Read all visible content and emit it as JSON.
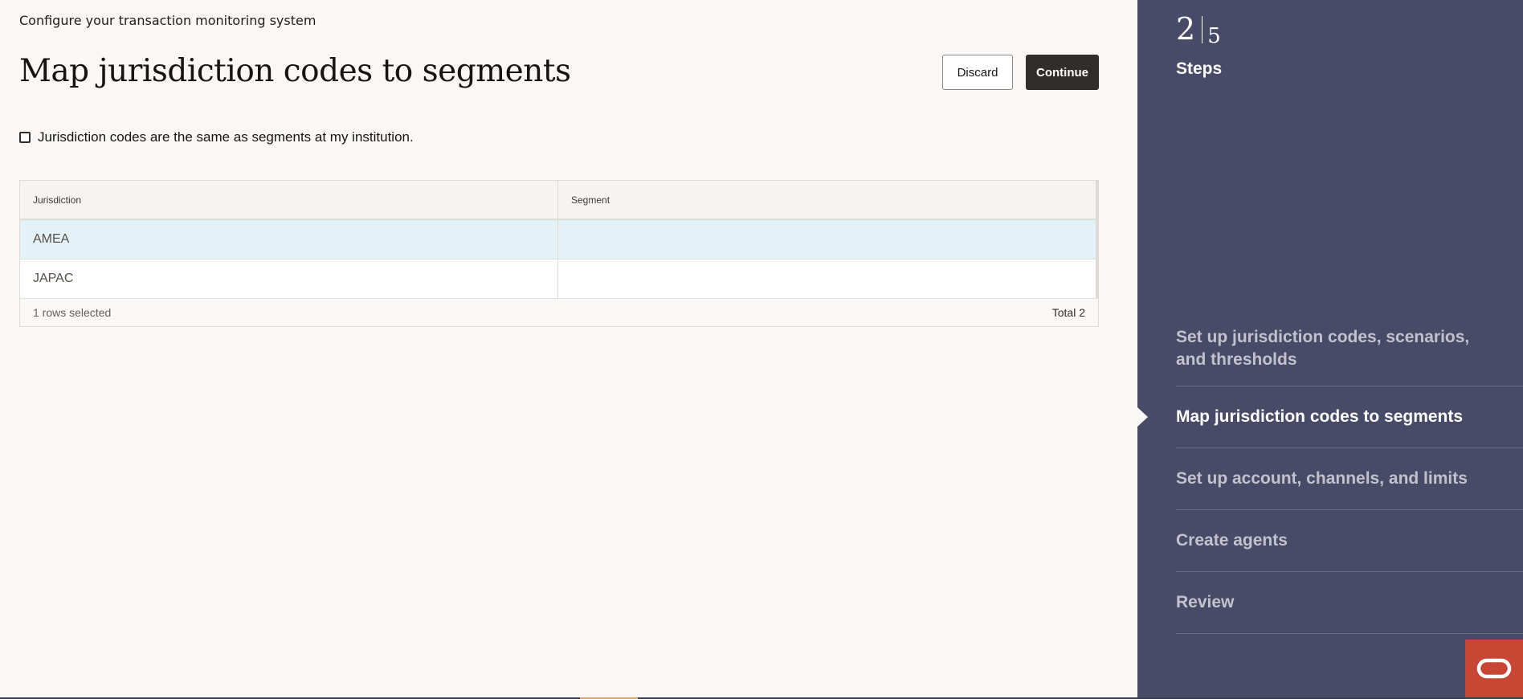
{
  "header": {
    "subtitle": "Configure your transaction monitoring system",
    "title": "Map jurisdiction codes to segments",
    "discard_label": "Discard",
    "continue_label": "Continue"
  },
  "checkbox": {
    "label": "Jurisdiction codes are the same as segments at my institution.",
    "checked": false
  },
  "table": {
    "columns": [
      "Jurisdiction",
      "Segment"
    ],
    "rows": [
      {
        "jurisdiction": "AMEA",
        "segment": "",
        "selected": true
      },
      {
        "jurisdiction": "JAPAC",
        "segment": "",
        "selected": false
      }
    ],
    "footer_selected": "1 rows selected",
    "footer_total": "Total 2"
  },
  "sidebar": {
    "current_step": "2",
    "total_steps": "5",
    "heading": "Steps",
    "steps": [
      {
        "label": "Set up jurisdiction codes, scenarios, and thresholds"
      },
      {
        "label": "Map jurisdiction codes to segments"
      },
      {
        "label": "Set up account, channels, and limits"
      },
      {
        "label": "Create agents"
      },
      {
        "label": "Review"
      }
    ],
    "active_index": 1
  },
  "colors": {
    "sidebar_bg": "#484b68",
    "primary_button": "#312d2a",
    "selected_row": "#e4f1f7",
    "brand_badge": "#c74634"
  },
  "icons": {
    "brand": "oracle-logo-icon"
  }
}
